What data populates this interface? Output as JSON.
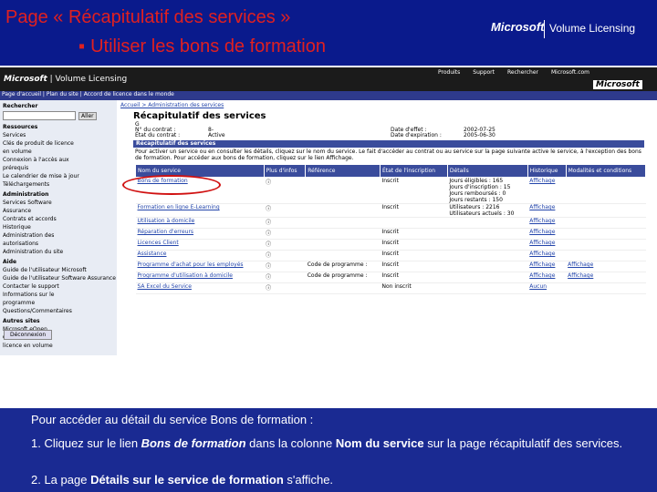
{
  "slide": {
    "title": "Page « Récapitulatif des services »",
    "subtitle": "Utiliser les bons de formation",
    "bullet": "▪",
    "logo_ms": "Microsoft",
    "logo_vl": "Volume Licensing"
  },
  "screenshot": {
    "header_logo_ms": "Microsoft",
    "header_logo_vl": "Volume Licensing",
    "top_nav": [
      "Produits",
      "Support",
      "Rechercher",
      "Microsoft.com"
    ],
    "brand": "Microsoft",
    "top_breadcrumb": "Page d'accueil | Plan du site | Accord de licence dans le monde",
    "sidebar": {
      "search_label": "Rechercher",
      "go_label": "Aller",
      "items": [
        {
          "text": "Ressources",
          "h": true
        },
        {
          "text": "Services",
          "h": false
        },
        {
          "text": "Clés de produit de licence",
          "h": false
        },
        {
          "text": "en volume",
          "h": false
        },
        {
          "text": "Connexion à l'accès aux",
          "h": false
        },
        {
          "text": "prérequis",
          "h": false
        },
        {
          "text": "Le calendrier de mise à jour",
          "h": false
        },
        {
          "text": "Téléchargements",
          "h": false
        },
        {
          "text": "Administration",
          "h": true
        },
        {
          "text": "Services Software",
          "h": false
        },
        {
          "text": "Assurance",
          "h": false
        },
        {
          "text": "Contrats et accords",
          "h": false
        },
        {
          "text": "Historique",
          "h": false
        },
        {
          "text": "Administration des",
          "h": false
        },
        {
          "text": "autorisations",
          "h": false
        },
        {
          "text": "Administration du site",
          "h": false
        },
        {
          "text": "Aide",
          "h": true
        },
        {
          "text": "Guide de l'utilisateur Microsoft",
          "h": false
        },
        {
          "text": "Guide de l'utilisateur Software Assurance",
          "h": false
        },
        {
          "text": "Contacter le support",
          "h": false
        },
        {
          "text": "Informations sur le",
          "h": false
        },
        {
          "text": "programme",
          "h": false
        },
        {
          "text": "Questions/Commentaires",
          "h": false
        },
        {
          "text": "Autres sites",
          "h": true
        },
        {
          "text": "Microsoft eOpen",
          "h": false
        },
        {
          "text": "Guide de la",
          "h": false
        },
        {
          "text": "licence en volume",
          "h": false
        }
      ],
      "logout_label": "Déconnexion"
    },
    "main": {
      "breadcrumb": "Accueil > Administration des services",
      "heading": "Récapitulatif des services",
      "info_rows": [
        {
          "k": "G",
          "v": "",
          "k2": "",
          "v2": ""
        },
        {
          "k": "N° du contrat :",
          "v": "8-",
          "k2": "Date d'effet :",
          "v2": "2002-07-25"
        },
        {
          "k": "État du contrat :",
          "v": "Active",
          "k2": "Date d'expiration :",
          "v2": "2005-06-30"
        }
      ],
      "section_title": "Récapitulatif des services",
      "description": "Pour activer un service ou en consulter les détails, cliquez sur le nom du service. Le fait d'accéder au contrat ou au service sur la page suivante active le service, à l'exception des bons de formation. Pour accéder aux bons de formation, cliquez sur le lien Affichage.",
      "table_headers": [
        "Nom du service",
        "Plus d'infos",
        "Référence",
        "État de l'inscription",
        "Détails",
        "Historique",
        "Modalités et conditions"
      ],
      "rows": [
        {
          "name": "Bons de formation",
          "info": "ⓘ",
          "ref": "",
          "state": "Inscrit",
          "details": "Jours éligibles : 165\nJours d'inscription : 15\nJours remboursés : 0\nJours restants : 150",
          "hist": "Affichage",
          "terms": ""
        },
        {
          "name": "Formation en ligne E-Learning",
          "info": "ⓘ",
          "ref": "",
          "state": "Inscrit",
          "details": "Utilisateurs : 2216\nUtilisateurs actuels : 30",
          "hist": "Affichage",
          "terms": ""
        },
        {
          "name": "Utilisation à domicile",
          "info": "ⓘ",
          "ref": "",
          "state": "",
          "details": "",
          "hist": "Affichage",
          "terms": ""
        },
        {
          "name": "Réparation d'erreurs",
          "info": "ⓘ",
          "ref": "",
          "state": "Inscrit",
          "details": "",
          "hist": "Affichage",
          "terms": ""
        },
        {
          "name": "Licences Client",
          "info": "ⓘ",
          "ref": "",
          "state": "Inscrit",
          "details": "",
          "hist": "Affichage",
          "terms": ""
        },
        {
          "name": "Assistance",
          "info": "ⓘ",
          "ref": "",
          "state": "Inscrit",
          "details": "",
          "hist": "Affichage",
          "terms": ""
        },
        {
          "name": "Programme d'achat pour les employés",
          "info": "ⓘ",
          "ref": "Code de programme :",
          "state": "Inscrit",
          "details": "",
          "hist": "Affichage",
          "terms": "Affichage"
        },
        {
          "name": "Programme d'utilisation à domicile",
          "info": "ⓘ",
          "ref": "Code de programme :",
          "state": "Inscrit",
          "details": "",
          "hist": "Affichage",
          "terms": "Affichage"
        },
        {
          "name": "SA Excel du Service",
          "info": "ⓘ",
          "ref": "",
          "state": "Non inscrit",
          "details": "",
          "hist": "Aucun",
          "terms": ""
        }
      ]
    }
  },
  "caption": {
    "intro": "Pour accéder au détail du service Bons de formation :",
    "step1_a": "1. Cliquez sur le lien ",
    "step1_b": "Bons de formation",
    "step1_c": " dans la colonne ",
    "step1_d": "Nom du service",
    "step1_e": " sur la page récapitulatif des services.",
    "step2_a": "2. La page ",
    "step2_b": "Détails sur le service de formation",
    "step2_c": " s'affiche."
  }
}
